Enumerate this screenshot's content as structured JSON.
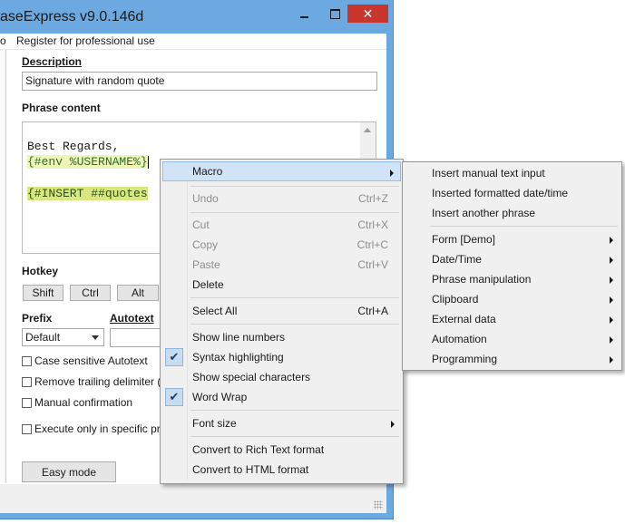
{
  "window": {
    "title": "aseExpress v9.0.146d",
    "close_glyph": "✕",
    "minimize_icon": "minimize-icon",
    "maximize_icon": "maximize-icon"
  },
  "menubar": {
    "items": [
      "o",
      "Register for professional use"
    ]
  },
  "form": {
    "description_label": "Description",
    "description_value": "Signature with random quote",
    "phrase_content_label": "Phrase content",
    "editor_lines": [
      "Best Regards,",
      "{#env %USERNAME%}",
      "{#INSERT ##quotes"
    ],
    "hotkey_label": "Hotkey",
    "hotkey_buttons": [
      "Shift",
      "Ctrl",
      "Alt"
    ],
    "prefix_label": "Prefix",
    "prefix_value": "Default",
    "autotext_label": "Autotext",
    "checkboxes": [
      "Case sensitive Autotext",
      "Remove trailing delimiter (po",
      "Manual confirmation",
      "Execute only in specific prog"
    ],
    "easy_mode_button": "Easy mode"
  },
  "context_menu": {
    "items": [
      {
        "label": "Macro",
        "submenu": true
      },
      {
        "label": "Undo",
        "shortcut": "Ctrl+Z",
        "disabled": true
      },
      {
        "label": "Cut",
        "shortcut": "Ctrl+X",
        "disabled": true
      },
      {
        "label": "Copy",
        "shortcut": "Ctrl+C",
        "disabled": true
      },
      {
        "label": "Paste",
        "shortcut": "Ctrl+V",
        "disabled": true
      },
      {
        "label": "Delete"
      },
      {
        "label": "Select All",
        "shortcut": "Ctrl+A"
      },
      {
        "label": "Show line numbers"
      },
      {
        "label": "Syntax highlighting",
        "checked": true
      },
      {
        "label": "Show special characters"
      },
      {
        "label": "Word Wrap",
        "checked": true
      },
      {
        "label": "Font size",
        "submenu": true
      },
      {
        "label": "Convert to Rich Text format"
      },
      {
        "label": "Convert to HTML format"
      }
    ]
  },
  "macro_submenu": {
    "items": [
      {
        "label": "Insert manual text input"
      },
      {
        "label": "Inserted formatted date/time"
      },
      {
        "label": "Insert another phrase"
      },
      {
        "label": "Form [Demo]",
        "submenu": true
      },
      {
        "label": "Date/Time",
        "submenu": true
      },
      {
        "label": "Phrase manipulation",
        "submenu": true
      },
      {
        "label": "Clipboard",
        "submenu": true
      },
      {
        "label": "External data",
        "submenu": true
      },
      {
        "label": "Automation",
        "submenu": true
      },
      {
        "label": "Programming",
        "submenu": true
      }
    ]
  },
  "colors": {
    "titlebar": "#6ba9e0",
    "close_button": "#c9372c",
    "menu_highlight": "#d1e3f6",
    "macro_highlight": "#eef6b7"
  }
}
